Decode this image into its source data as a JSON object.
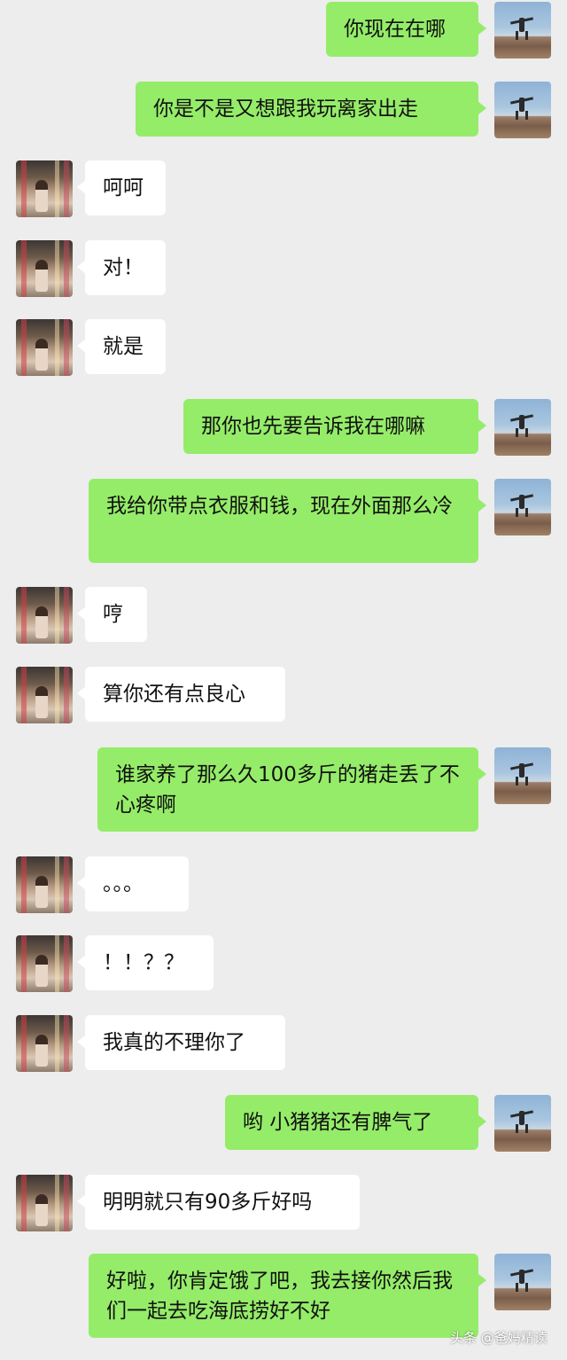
{
  "chat": {
    "messages": [
      {
        "sender": "me",
        "text": "你现在在哪"
      },
      {
        "sender": "me",
        "text": "你是不是又想跟我玩离家出走"
      },
      {
        "sender": "them",
        "text": "呵呵"
      },
      {
        "sender": "them",
        "text": "对！"
      },
      {
        "sender": "them",
        "text": "就是"
      },
      {
        "sender": "me",
        "text": "那你也先要告诉我在哪嘛"
      },
      {
        "sender": "me",
        "text": "我给你带点衣服和钱，现在外面那么冷"
      },
      {
        "sender": "them",
        "text": "哼"
      },
      {
        "sender": "them",
        "text": "算你还有点良心"
      },
      {
        "sender": "me",
        "text": "谁家养了那么久100多斤的猪走丢了不心疼啊"
      },
      {
        "sender": "them",
        "text": "。。。"
      },
      {
        "sender": "them",
        "text": "！！？？"
      },
      {
        "sender": "them",
        "text": "我真的不理你了"
      },
      {
        "sender": "me",
        "text": "哟 小猪猪还有脾气了"
      },
      {
        "sender": "them",
        "text": "明明就只有90多斤好吗"
      },
      {
        "sender": "me",
        "text": "好啦，你肯定饿了吧，我去接你然后我们一起去吃海底捞好不好"
      }
    ]
  },
  "watermark": "头条 @爸妈精读",
  "colors": {
    "background": "#ededed",
    "my_bubble": "#95ec69",
    "their_bubble": "#ffffff"
  }
}
